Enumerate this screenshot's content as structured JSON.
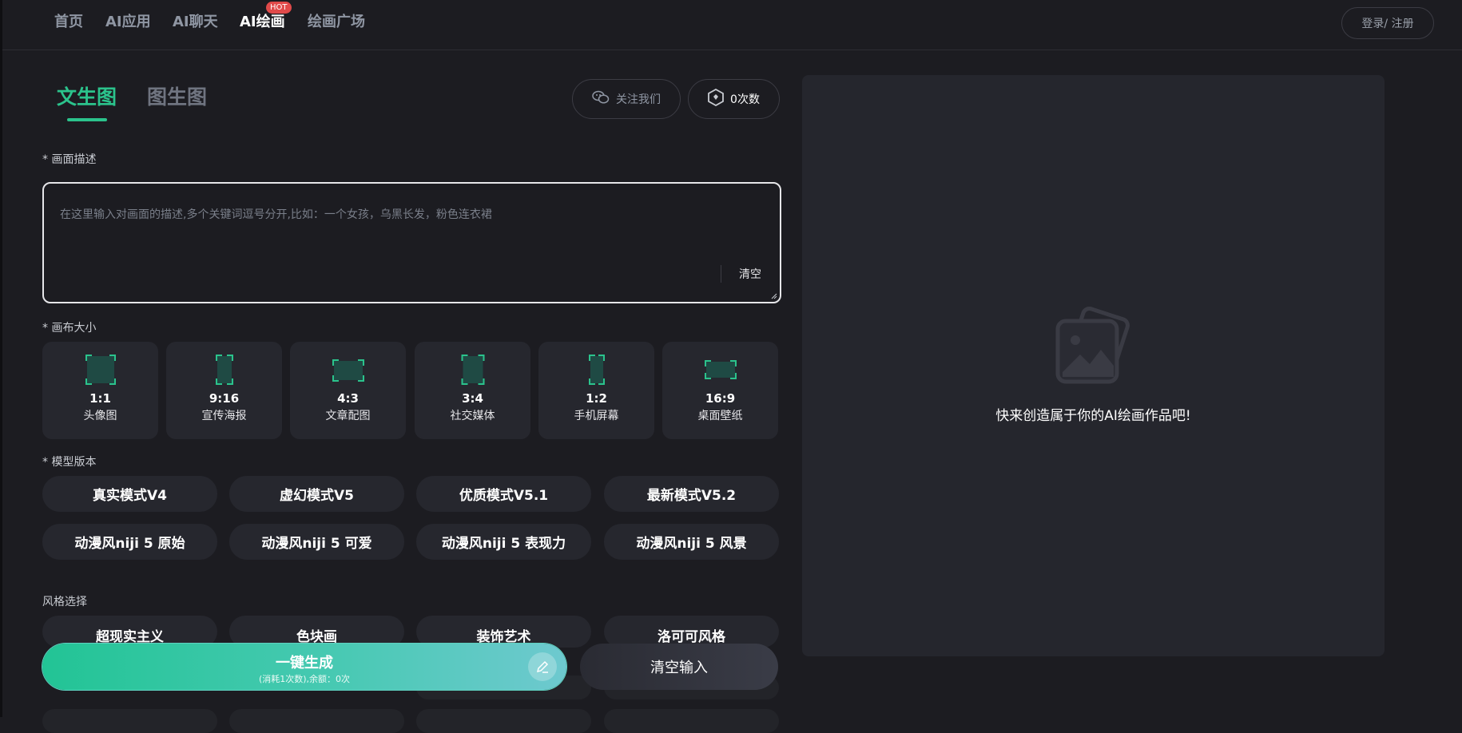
{
  "nav": {
    "items": [
      "首页",
      "AI应用",
      "AI聊天",
      "AI绘画",
      "绘画广场"
    ],
    "hot_badge": "HOT",
    "login": "登录/ 注册"
  },
  "tabs": {
    "active": "文生图",
    "inactive": "图生图"
  },
  "actions": {
    "follow": "关注我们",
    "count": "0次数"
  },
  "prompt": {
    "label": "* 画面描述",
    "placeholder": "在这里输入对画面的描述,多个关键词逗号分开,比如：一个女孩，乌黑长发，粉色连衣裙",
    "clear": "清空"
  },
  "canvas": {
    "label": "* 画布大小",
    "sizes": [
      {
        "ratio": "1:1",
        "desc": "头像图"
      },
      {
        "ratio": "9:16",
        "desc": "宣传海报"
      },
      {
        "ratio": "4:3",
        "desc": "文章配图"
      },
      {
        "ratio": "3:4",
        "desc": "社交媒体"
      },
      {
        "ratio": "1:2",
        "desc": "手机屏幕"
      },
      {
        "ratio": "16:9",
        "desc": "桌面壁纸"
      }
    ]
  },
  "model": {
    "label": "* 模型版本",
    "options": [
      "真实模式V4",
      "虚幻模式V5",
      "优质模式V5.1",
      "最新模式V5.2",
      "动漫风niji 5 原始",
      "动漫风niji 5 可爱",
      "动漫风niji 5 表现力",
      "动漫风niji 5 风景"
    ]
  },
  "style": {
    "label": "风格选择",
    "options": [
      "超现实主义",
      "色块画",
      "装饰艺术",
      "洛可可风格"
    ]
  },
  "generate": {
    "label": "一键生成",
    "sub": "(消耗1次数),余额：0次"
  },
  "clear_input": "清空输入",
  "preview": {
    "caption": "快来创造属于你的AI绘画作品吧!"
  },
  "colors": {
    "accent": "#2bc38c",
    "background": "#1c1c21",
    "card": "#26272e",
    "hot": "#e04a4a"
  }
}
